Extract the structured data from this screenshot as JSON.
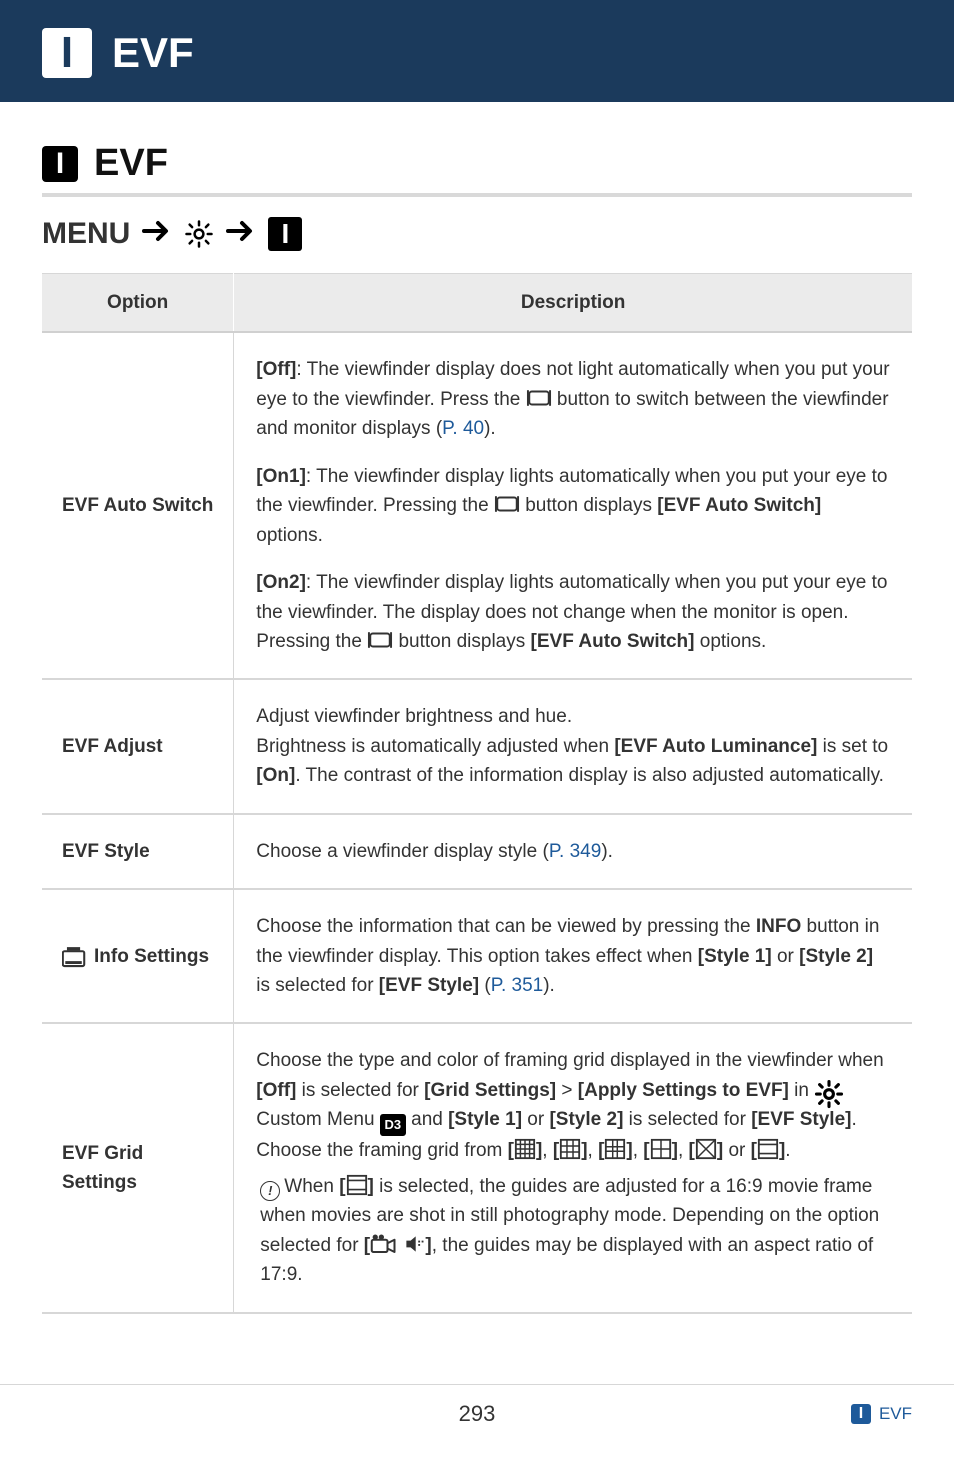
{
  "banner": {
    "badge_letter": "I",
    "title": "EVF"
  },
  "section": {
    "badge_letter": "I",
    "title": "EVF"
  },
  "menu_path": {
    "label": "MENU",
    "badge_letter": "I"
  },
  "table": {
    "headers": {
      "option": "Option",
      "description": "Description"
    },
    "rows": {
      "evf_auto_switch": {
        "name": "EVF Auto Switch",
        "off_label": "[Off]",
        "off_text_a": ": The viewfinder display does not light automatically when you put your eye to the viewfinder. Press the ",
        "off_text_b": " button to switch between the viewfinder and monitor displays (",
        "off_link": "P. 40",
        "off_text_c": ").",
        "on1_label": "[On1]",
        "on1_text_a": ": The viewfinder display lights automatically when you put your eye to the viewfinder. Pressing the ",
        "on1_text_b": " button displays ",
        "on1_bold": "[EVF Auto Switch]",
        "on1_text_c": " options.",
        "on2_label": "[On2]",
        "on2_text_a": ": The viewfinder display lights automatically when you put your eye to the viewfinder. The display does not change when the monitor is open. Pressing the ",
        "on2_text_b": " button displays ",
        "on2_bold": "[EVF Auto Switch]",
        "on2_text_c": " options."
      },
      "evf_adjust": {
        "name": "EVF Adjust",
        "line1": "Adjust viewfinder brightness and hue.",
        "line2a": "Brightness is automatically adjusted when ",
        "line2bold": "[EVF Auto Luminance]",
        "line2b": " is set to ",
        "line3bold": "[On]",
        "line3": ". The contrast of the information display is also adjusted automatically."
      },
      "evf_style": {
        "name": "EVF Style",
        "text_a": "Choose a viewfinder display style (",
        "link": "P. 349",
        "text_b": ")."
      },
      "info_settings": {
        "name": "Info Settings",
        "text_a": "Choose the information that can be viewed by pressing the ",
        "info_bold": "INFO",
        "text_b": " button in the viewfinder display. This option takes effect when ",
        "style1": "[Style 1]",
        "or": " or ",
        "style2": "[Style 2]",
        "text_c": " is selected for ",
        "evf_style_bold": "[EVF Style]",
        "text_d": " (",
        "link": "P. 351",
        "text_e": ")."
      },
      "evf_grid": {
        "name": "EVF Grid Settings",
        "p1a": "Choose the type and color of framing grid displayed in the viewfinder when ",
        "off_bold": "[Off]",
        "p1b": " is selected for ",
        "grid_settings_bold": "[Grid Settings]",
        "gt": " > ",
        "apply_bold": "[Apply Settings to EVF]",
        "p1c": " in ",
        "custom": " Custom Menu ",
        "and": " and ",
        "style1": "[Style 1]",
        "or": " or ",
        "style2": "[Style 2]",
        "p1d": " is selected for ",
        "evf_style_bold": "[EVF Style]",
        "p1e": ". Choose the framing grid from ",
        "grid_list_sep": ", ",
        "grid_or": " or ",
        "p1f": ".",
        "note_a": "When ",
        "note_b": " is selected, the guides are adjusted for a 16:9 movie frame when movies are shot in still photography mode. Depending on the option selected for ",
        "note_c": ", the guides may be displayed with an aspect ratio of 17:9.",
        "movie_bracket_open": "[",
        "movie_bracket_close": "]"
      }
    }
  },
  "footer": {
    "page": "293",
    "crumb_badge": "I",
    "crumb_text": "EVF"
  }
}
